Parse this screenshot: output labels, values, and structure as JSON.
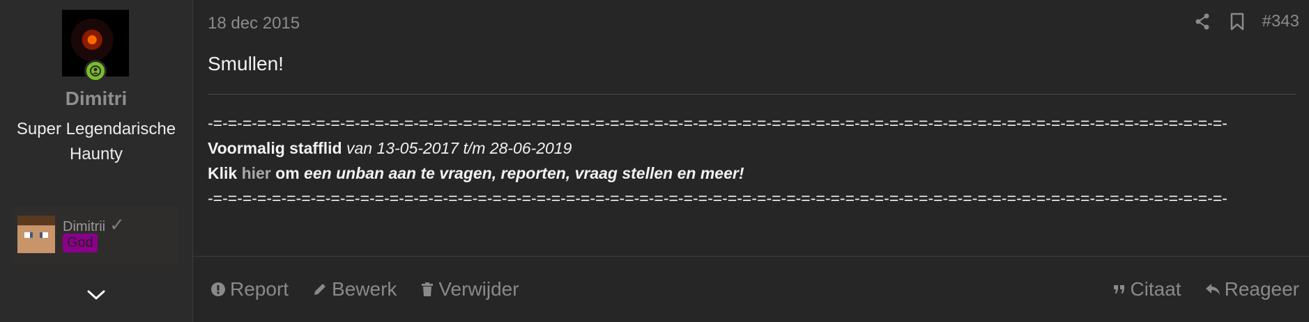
{
  "user": {
    "name": "Dimitri",
    "title": "Super Legendarische Haunty",
    "linked_account": {
      "name": "Dimitrii",
      "rank": "God"
    }
  },
  "post": {
    "date": "18 dec 2015",
    "number": "#343",
    "message": "Smullen!"
  },
  "signature": {
    "separator": "-=-=-=-=-=-=-=-=-=-=-=-=-=-=-=-=-=-=-=-=-=-=-=-=-=-=-=-=-=-=-=-=-=-=-=-=-=-=-=-=-=-=-=-=-=-=-=-=-=-=-=-=-=-=-=-=-=-=-=-=-=-=-=-=-=-=-=-=-=-",
    "former_staff_label": "Voormalig stafflid",
    "former_staff_period": "van 13-05-2017 t/m 28-06-2019",
    "click_label": "Klik",
    "link_text": "hier",
    "om_text": "om",
    "click_rest": "een unban aan te vragen, reporten, vraag stellen en meer!"
  },
  "actions": {
    "report": "Report",
    "edit": "Bewerk",
    "delete": "Verwijder",
    "quote": "Citaat",
    "reply": "Reageer"
  },
  "icons": {
    "online": "user-online-icon",
    "expand": "chevron-down-icon",
    "share": "share-icon",
    "bookmark": "bookmark-icon",
    "report": "exclamation-circle-icon",
    "edit": "pencil-icon",
    "delete": "trash-icon",
    "quote": "quote-icon",
    "reply": "reply-icon"
  },
  "colors": {
    "background": "#262626",
    "sidebar": "#2b2b2c",
    "online_badge": "#7bbd2a",
    "rank_badge": "#8b008b",
    "muted_text": "#8a8a8a"
  }
}
